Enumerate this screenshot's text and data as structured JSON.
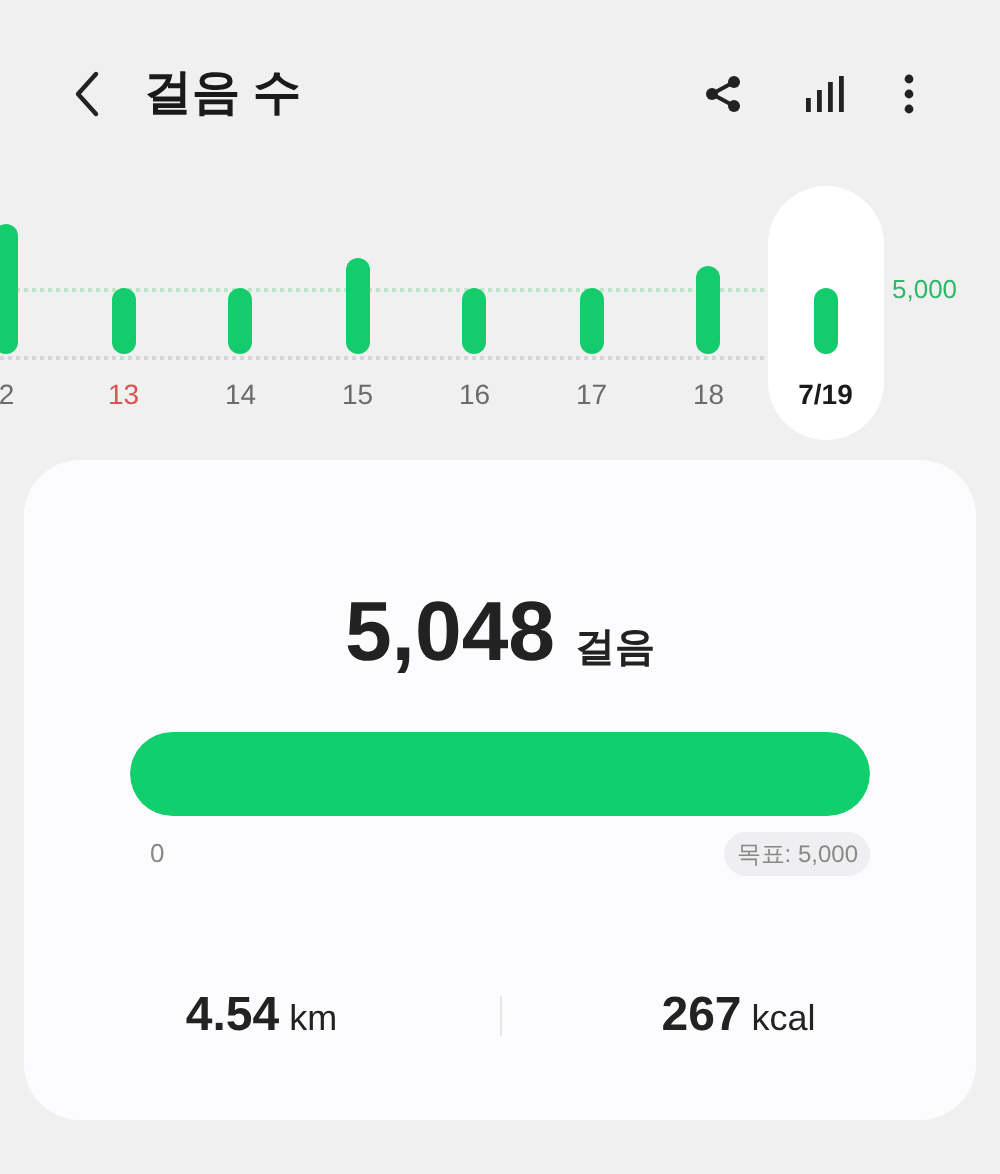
{
  "header": {
    "title": "걸음 수"
  },
  "chart": {
    "goal_label": "5,000",
    "days": [
      {
        "label": "2",
        "selected": false,
        "color": "#6b6b6b"
      },
      {
        "label": "13",
        "selected": false,
        "color": "#d9534f"
      },
      {
        "label": "14",
        "selected": false,
        "color": "#6b6b6b"
      },
      {
        "label": "15",
        "selected": false,
        "color": "#6b6b6b"
      },
      {
        "label": "16",
        "selected": false,
        "color": "#6b6b6b"
      },
      {
        "label": "17",
        "selected": false,
        "color": "#6b6b6b"
      },
      {
        "label": "18",
        "selected": false,
        "color": "#6b6b6b"
      },
      {
        "label": "7/19",
        "selected": true,
        "color": "#1a1a1a"
      }
    ]
  },
  "summary": {
    "steps": "5,048",
    "steps_unit": "걸음",
    "level": 1,
    "min_label": "0",
    "goal_label": "목표: 5,000",
    "stats": [
      {
        "value": "4.54",
        "unit": "km"
      },
      {
        "value": "267",
        "unit": "kcal"
      }
    ]
  }
}
